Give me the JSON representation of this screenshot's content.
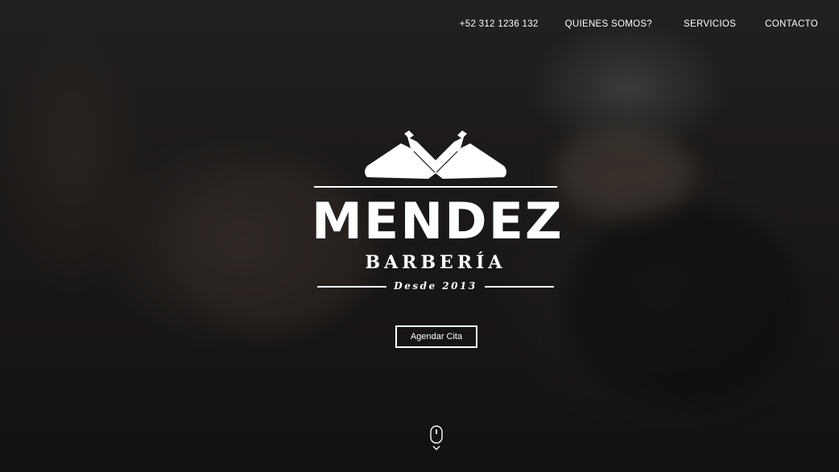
{
  "nav": {
    "phone": "+52 312 1236 132",
    "items": [
      {
        "label": "QUIENES SOMOS?"
      },
      {
        "label": "SERVICIOS"
      },
      {
        "label": "CONTACTO"
      }
    ]
  },
  "logo": {
    "title": "MENDEZ",
    "subtitle": "BARBERÍA",
    "tagline": "Desde 2013",
    "icon": "crossed-razors-icon"
  },
  "hero": {
    "cta_label": "Agendar Cita",
    "scroll_icon": "mouse-scroll-icon"
  },
  "colors": {
    "text": "#ffffff",
    "overlay": "#000000"
  }
}
